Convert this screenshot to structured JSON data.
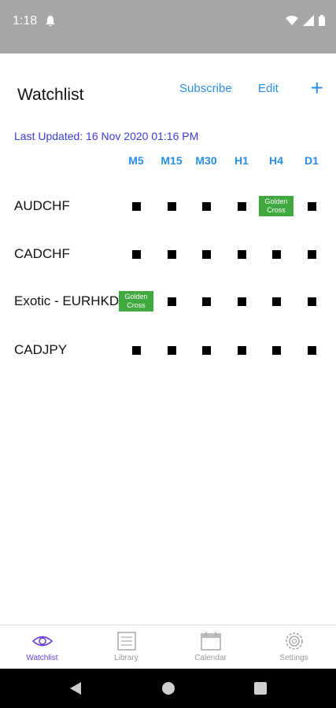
{
  "status": {
    "time": "1:18"
  },
  "header": {
    "title": "Watchlist",
    "subscribe": "Subscribe",
    "edit": "Edit",
    "add": "+"
  },
  "last_updated": "Last Updated: 16 Nov 2020 01:16 PM",
  "columns": [
    "M5",
    "M15",
    "M30",
    "H1",
    "H4",
    "D1"
  ],
  "rows": [
    {
      "label": "AUDCHF",
      "cells": [
        "square",
        "square",
        "square",
        "square",
        "golden",
        "square"
      ]
    },
    {
      "label": "CADCHF",
      "cells": [
        "square",
        "square",
        "square",
        "square",
        "square",
        "square"
      ]
    },
    {
      "label": "Exotic - EURHKD",
      "cells": [
        "golden",
        "square",
        "square",
        "square",
        "square",
        "square"
      ]
    },
    {
      "label": "CADJPY",
      "cells": [
        "square",
        "square",
        "square",
        "square",
        "square",
        "square"
      ]
    }
  ],
  "golden_label": {
    "line1": "Golden",
    "line2": "Cross"
  },
  "tabs": [
    {
      "label": "Watchlist",
      "icon": "eye-icon",
      "active": true
    },
    {
      "label": "Library",
      "icon": "list-icon",
      "active": false
    },
    {
      "label": "Calendar",
      "icon": "calendar-icon",
      "active": false
    },
    {
      "label": "Settings",
      "icon": "gear-icon",
      "active": false
    }
  ],
  "colors": {
    "accent": "#2a8de8",
    "updated_text": "#3a3ae0",
    "golden_cross": "#3fa83f",
    "active_tab": "#6b3fe0"
  }
}
